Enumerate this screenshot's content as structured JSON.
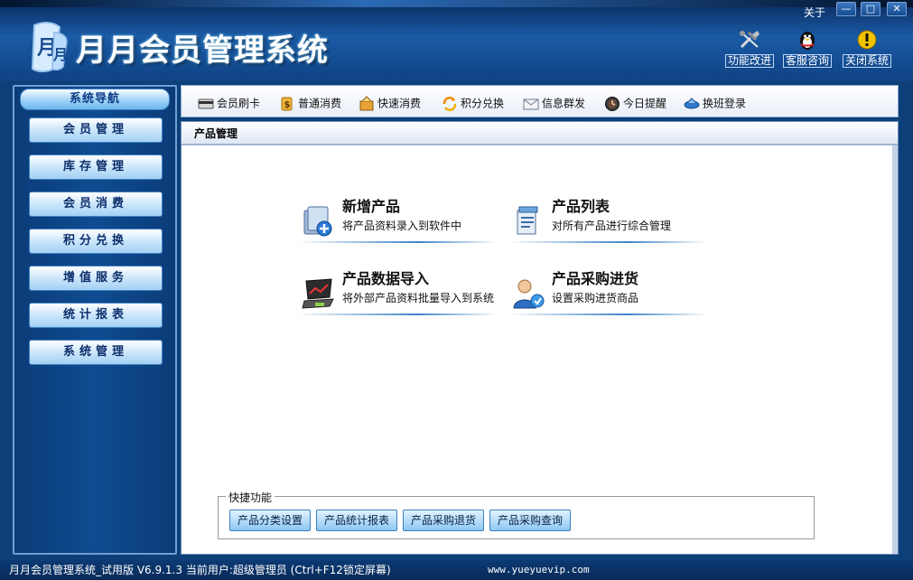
{
  "window": {
    "title": "月月会员管理系统",
    "about": "关于",
    "min": "—",
    "max": "□",
    "close": "✕"
  },
  "top_buttons": [
    {
      "label": "功能改进",
      "icon": "tools-icon"
    },
    {
      "label": "客服咨询",
      "icon": "qq-penguin-icon"
    },
    {
      "label": "关闭系统",
      "icon": "warning-icon"
    }
  ],
  "sidebar": {
    "header": "系统导航",
    "items": [
      {
        "label": "会员管理"
      },
      {
        "label": "库存管理"
      },
      {
        "label": "会员消费"
      },
      {
        "label": "积分兑换"
      },
      {
        "label": "增值服务"
      },
      {
        "label": "统计报表"
      },
      {
        "label": "系统管理"
      }
    ]
  },
  "toolbar": {
    "items": [
      {
        "label": "会员刷卡",
        "icon": "card-swipe-icon"
      },
      {
        "label": "普通消费",
        "icon": "money-icon"
      },
      {
        "label": "快速消费",
        "icon": "fast-consume-icon"
      },
      {
        "label": "积分兑换",
        "icon": "exchange-icon"
      },
      {
        "label": "信息群发",
        "icon": "mail-icon"
      },
      {
        "label": "今日提醒",
        "icon": "clock-icon"
      },
      {
        "label": "换班登录",
        "icon": "shift-login-icon"
      }
    ]
  },
  "panel": {
    "title": "产品管理",
    "features": [
      {
        "title": "新增产品",
        "desc": "将产品资料录入到软件中",
        "icon": "add-product-icon"
      },
      {
        "title": "产品列表",
        "desc": "对所有产品进行综合管理",
        "icon": "product-list-icon"
      },
      {
        "title": "产品数据导入",
        "desc": "将外部产品资料批量导入到系统",
        "icon": "laptop-import-icon"
      },
      {
        "title": "产品采购进货",
        "desc": "设置采购进货商品",
        "icon": "purchase-icon"
      }
    ],
    "quick": {
      "legend": "快捷功能",
      "buttons": [
        {
          "label": "产品分类设置"
        },
        {
          "label": "产品统计报表"
        },
        {
          "label": "产品采购退货"
        },
        {
          "label": "产品采购查询"
        }
      ]
    }
  },
  "status": {
    "text": "月月会员管理系统_试用版 V6.9.1.3 当前用户:超级管理员 (Ctrl+F12锁定屏幕)",
    "url": "www.yueyuevip.com"
  }
}
